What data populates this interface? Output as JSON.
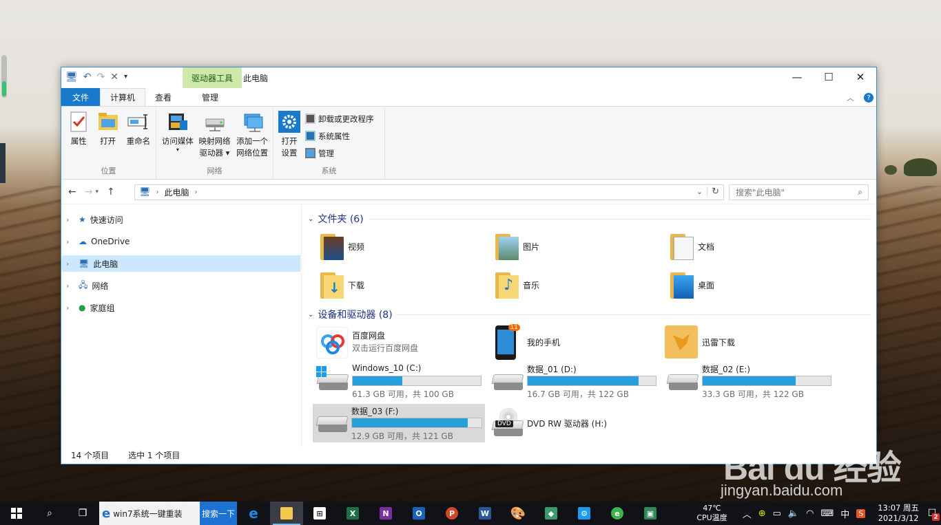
{
  "window": {
    "context_tab": "驱动器工具",
    "title": "此电脑",
    "controls": {
      "minimize": "—",
      "maximize": "☐",
      "close": "✕"
    }
  },
  "tabs": [
    "文件",
    "计算机",
    "查看",
    "管理"
  ],
  "ribbon": {
    "groups": [
      {
        "label": "位置",
        "buttons": [
          "属性",
          "打开",
          "重命名"
        ]
      },
      {
        "label": "网络",
        "buttons": [
          "访问媒体",
          "映射网络",
          "驱动器",
          "添加一个",
          "网络位置"
        ]
      },
      {
        "label": "系统",
        "open_btn": [
          "打开",
          "设置"
        ],
        "small": [
          "卸载或更改程序",
          "系统属性",
          "管理"
        ]
      }
    ]
  },
  "address": {
    "path": "此电脑",
    "search_placeholder": "搜索\"此电脑\""
  },
  "nav": {
    "items": [
      "快速访问",
      "OneDrive",
      "此电脑",
      "网络",
      "家庭组"
    ]
  },
  "folders_section": "文件夹 (6)",
  "folders": [
    "视频",
    "图片",
    "文档",
    "下载",
    "音乐",
    "桌面"
  ],
  "drives_section": "设备和驱动器 (8)",
  "apps": [
    {
      "name": "百度网盘",
      "sub": "双击运行百度网盘"
    },
    {
      "name": "我的手机",
      "badge": "11"
    },
    {
      "name": "迅雷下载"
    }
  ],
  "drives": [
    {
      "name": "Windows_10 (C:)",
      "size": "61.3 GB 可用，共 100 GB",
      "used": 0.387
    },
    {
      "name": "数据_01 (D:)",
      "size": "16.7 GB 可用，共 122 GB",
      "used": 0.863
    },
    {
      "name": "数据_02 (E:)",
      "size": "33.3 GB 可用，共 122 GB",
      "used": 0.727
    },
    {
      "name": "数据_03 (F:)",
      "size": "12.9 GB 可用，共 121 GB",
      "used": 0.893
    },
    {
      "name": "DVD RW 驱动器 (H:)",
      "icon_text": "DVD"
    }
  ],
  "status": {
    "count": "14 个项目",
    "selected": "选中 1 个项目"
  },
  "taskbar": {
    "ie_text": "win7系统一键重装",
    "ie_btn": "搜索一下",
    "temp": "47℃",
    "temp_label": "CPU温度",
    "ime": "中",
    "time": "13:07 周五",
    "date": "2021/3/12",
    "notify_count": "2"
  },
  "watermark": {
    "logo": "Bai du 经验",
    "url": "jingyan.baidu.com"
  }
}
